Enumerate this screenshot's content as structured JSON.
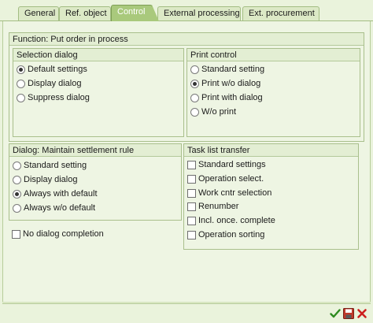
{
  "tabs": [
    {
      "label": "General",
      "active": false
    },
    {
      "label": "Ref. object",
      "active": false
    },
    {
      "label": "Control",
      "active": true
    },
    {
      "label": "External processing",
      "active": false
    },
    {
      "label": "Ext. procurement",
      "active": false
    }
  ],
  "function_group": {
    "title": "Function: Put order in process"
  },
  "selection_dialog": {
    "title": "Selection dialog",
    "options": [
      {
        "label": "Default settings",
        "selected": true
      },
      {
        "label": "Display dialog",
        "selected": false
      },
      {
        "label": "Suppress dialog",
        "selected": false
      }
    ]
  },
  "print_control": {
    "title": "Print control",
    "options": [
      {
        "label": "Standard setting",
        "selected": false
      },
      {
        "label": "Print w/o dialog",
        "selected": true
      },
      {
        "label": "Print with dialog",
        "selected": false
      },
      {
        "label": "W/o print",
        "selected": false
      }
    ]
  },
  "settlement_rule": {
    "title": "Dialog: Maintain settlement rule",
    "options": [
      {
        "label": "Standard setting",
        "selected": false
      },
      {
        "label": "Display dialog",
        "selected": false
      },
      {
        "label": "Always with default",
        "selected": true
      },
      {
        "label": "Always w/o default",
        "selected": false
      }
    ]
  },
  "no_dialog_completion": {
    "label": "No dialog completion",
    "checked": false
  },
  "task_list_transfer": {
    "title": "Task list transfer",
    "options": [
      {
        "label": "Standard settings",
        "checked": false
      },
      {
        "label": "Operation select.",
        "checked": false
      },
      {
        "label": "Work cntr selection",
        "checked": false
      },
      {
        "label": "Renumber",
        "checked": false
      },
      {
        "label": "Incl. once. complete",
        "checked": false
      },
      {
        "label": "Operation sorting",
        "checked": false
      }
    ]
  },
  "buttons": {
    "confirm_icon": "check-icon",
    "save_icon": "save-icon",
    "cancel_icon": "cancel-icon",
    "colors": {
      "confirm": "#2e8b1f",
      "cancel": "#cc2020",
      "save_body": "#c0392b"
    }
  },
  "colors": {
    "background": "#eaf3dc",
    "active_tab": "#a9c97c",
    "border": "#a9bf8c"
  }
}
